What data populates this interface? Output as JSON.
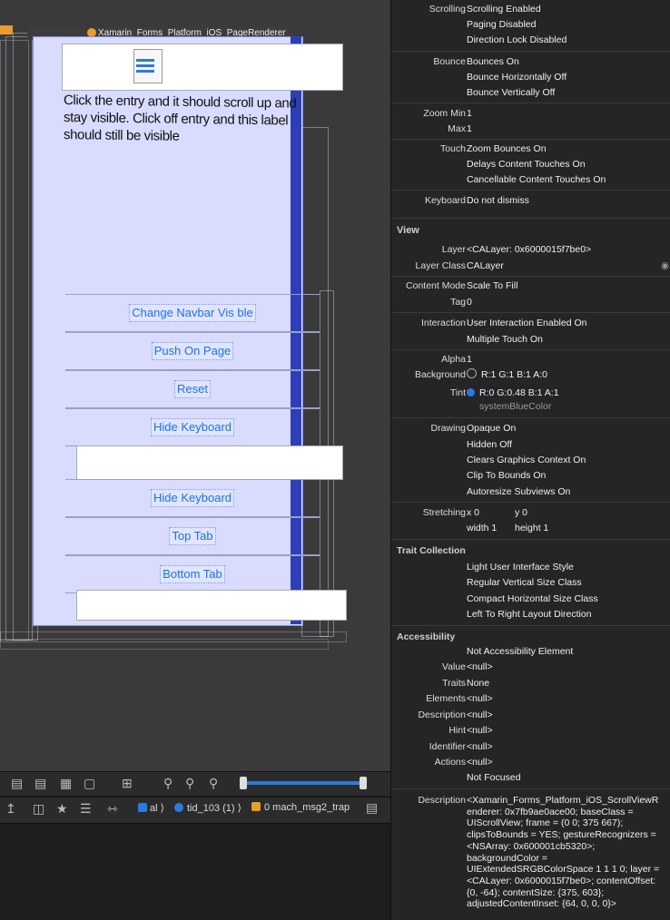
{
  "canvas": {
    "title": "Xamarin_Forms_Platform_iOS_PageRenderer",
    "message": "Click the entry and it should scroll up and stay visible. Click off entry and this label should still be visible",
    "buttons": [
      "Change Navbar Vis ble",
      "Push On Page",
      "Reset",
      "Hide Keyboard",
      "Hide Keyboard",
      "Top Tab",
      "Bottom Tab"
    ]
  },
  "toolbar": {
    "breadcrumb_app": "al",
    "breadcrumb_thread": "tid_103 (1)",
    "breadcrumb_frame": "0 mach_msg2_trap"
  },
  "inspector": {
    "scrolling": [
      "Scrolling Enabled",
      "Paging Disabled",
      "Direction Lock Disabled"
    ],
    "bounce": [
      "Bounces On",
      "Bounce Horizontally Off",
      "Bounce Vertically Off"
    ],
    "zoom_min": "1",
    "zoom_max": "1",
    "touch": [
      "Zoom Bounces On",
      "Delays Content Touches On",
      "Cancellable Content Touches On"
    ],
    "keyboard": "Do not dismiss",
    "view_section": "View",
    "layer": "<CALayer: 0x6000015f7be0>",
    "layer_class": "CALayer",
    "content_mode": "Scale To Fill",
    "tag": "0",
    "interaction": [
      "User Interaction Enabled On",
      "Multiple Touch On"
    ],
    "alpha": "1",
    "background": "R:1 G:1 B:1 A:0",
    "tint": "R:0 G:0.48 B:1 A:1",
    "tint_name": "systemBlueColor",
    "drawing": [
      "Opaque On",
      "Hidden Off",
      "Clears Graphics Context On",
      "Clip To Bounds On",
      "Autoresize Subviews On"
    ],
    "stretching_x": "x 0",
    "stretching_y": "y 0",
    "stretching_w": "width 1",
    "stretching_h": "height 1",
    "trait_section": "Trait Collection",
    "traits": [
      "Light User Interface Style",
      "Regular Vertical Size Class",
      "Compact Horizontal Size Class",
      "Left To Right Layout Direction"
    ],
    "accessibility_section": "Accessibility",
    "not_accessibility": "Not Accessibility Element",
    "value": "<null>",
    "traits_value": "None",
    "elements": "<null>",
    "description_short": "<null>",
    "hint": "<null>",
    "identifier": "<null>",
    "actions": "<null>",
    "not_focused": "Not Focused",
    "description_long": "<Xamarin_Forms_Platform_iOS_ScrollViewR\nenderer: 0x7fb9ae0ace00; baseClass =\nUIScrollView; frame = (0 0; 375 667);\nclipsToBounds = YES; gestureRecognizers =\n<NSArray: 0x600001cb5320>;\nbackgroundColor =\nUIExtendedSRGBColorSpace 1 1 1 0; layer =\n<CALayer: 0x6000015f7be0>; contentOffset:\n{0, -64}; contentSize: {375, 603};\nadjustedContentInset: {64, 0, 0, 0}>"
  },
  "labels": {
    "scrolling": "Scrolling",
    "bounce": "Bounce",
    "zoom_min": "Zoom Min",
    "max": "Max",
    "touch": "Touch",
    "keyboard": "Keyboard",
    "layer": "Layer",
    "layer_class": "Layer Class",
    "content_mode": "Content Mode",
    "tag": "Tag",
    "interaction": "Interaction",
    "alpha": "Alpha",
    "background": "Background",
    "tint": "Tint",
    "drawing": "Drawing",
    "stretching": "Stretching",
    "value": "Value",
    "traits": "Traits",
    "elements": "Elements",
    "description": "Description",
    "hint": "Hint",
    "identifier": "Identifier",
    "actions": "Actions"
  },
  "colors": {
    "accent": "#2a7bde",
    "canvas_bg": "#3a3a3c",
    "inspector_bg": "#252527",
    "screen_fill": "#d9dcff"
  }
}
